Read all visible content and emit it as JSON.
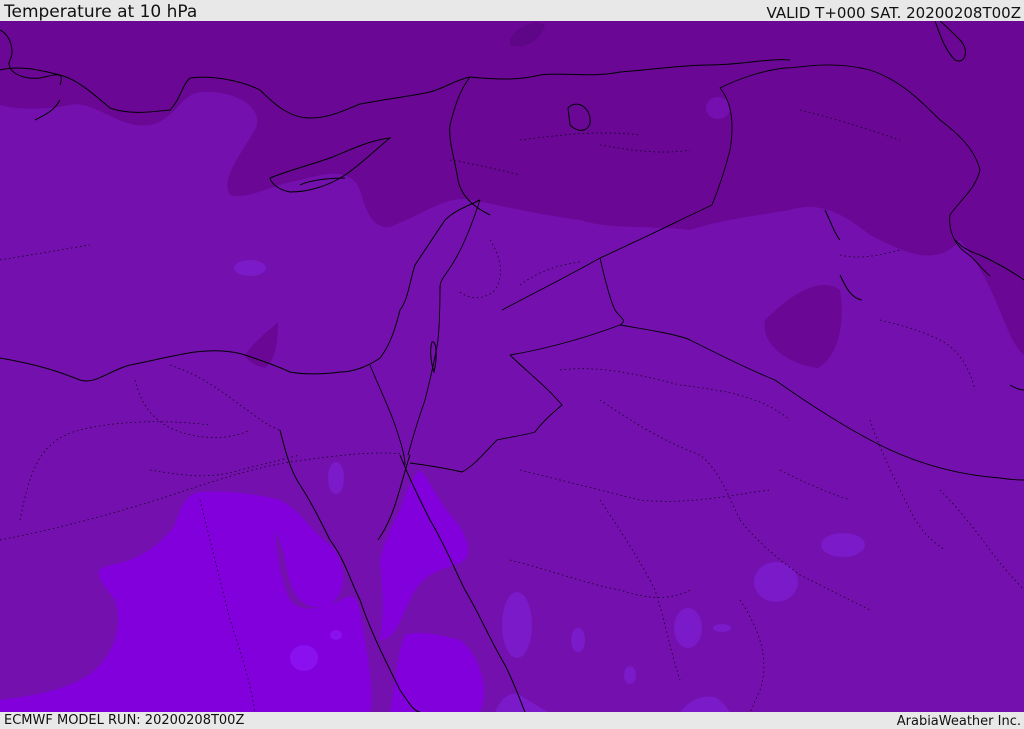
{
  "header": {
    "title": "Temperature at 10 hPa",
    "valid": "VALID T+000 SAT. 20200208T00Z"
  },
  "footer": {
    "model_run": "ECMWF MODEL RUN: 20200208T00Z",
    "credit": "ArabiaWeather Inc."
  },
  "colors": {
    "band_cold": "#6a0798",
    "band_mid": "#760fb0",
    "band_warm": "#8100dd",
    "band_warm2": "#7a1ac8",
    "coast_line": "#000000"
  }
}
